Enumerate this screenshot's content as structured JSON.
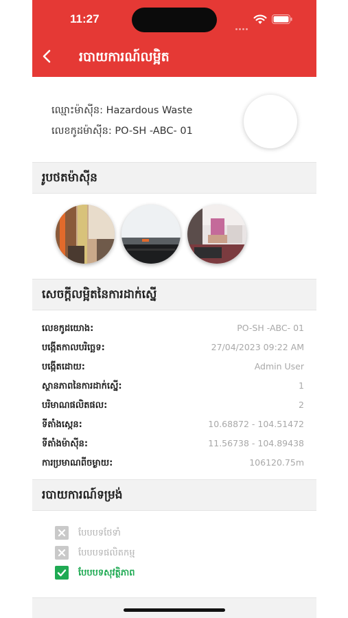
{
  "status_bar": {
    "time": "11:27"
  },
  "header": {
    "title": "របាយការណ៍លម្អិត"
  },
  "machine": {
    "name_label": "ឈ្មោះម៉ាស៊ីន:",
    "name_value": "Hazardous Waste",
    "code_label": "លេខកូដម៉ាស៊ីន:",
    "code_value": "PO-SH -ABC- 01"
  },
  "photos_section": {
    "title": "រូបថតម៉ាស៊ីន"
  },
  "details_section": {
    "title": "សេចក្ដីលម្អិតនៃការដាក់ស្នើ",
    "rows": [
      {
        "label": "លេខកូដយោង:",
        "value": "PO-SH -ABC- 01"
      },
      {
        "label": "បង្កើតកាលបរិច្ឆេទ:",
        "value": "27/04/2023 09:22 AM"
      },
      {
        "label": "បង្កើតដោយ:",
        "value": "Admin User"
      },
      {
        "label": "ស្ថានភាពនៃការដាក់ស្នើ:",
        "value": "1"
      },
      {
        "label": "បរិមាណផលិតផល:",
        "value": "2"
      },
      {
        "label": "ទីតាំងស្កេន:",
        "value": "10.68872 - 104.51472"
      },
      {
        "label": "ទីតាំងម៉ាស៊ីន:",
        "value": "11.56738 - 104.89438"
      },
      {
        "label": "ការប្រមាណពីចម្ងាយ:",
        "value": "106120.75m"
      }
    ]
  },
  "form_section": {
    "title": "របាយការណ៍ទម្រង់",
    "items": [
      {
        "label": "បែបបទថែទាំ",
        "checked": false
      },
      {
        "label": "បែបបទផលិតកម្ម",
        "checked": false
      },
      {
        "label": "បែបបទសុវត្ថិភាព",
        "checked": true
      }
    ]
  },
  "colors": {
    "primary": "#e53935",
    "success": "#1faa53",
    "muted": "#c9c9c9"
  }
}
